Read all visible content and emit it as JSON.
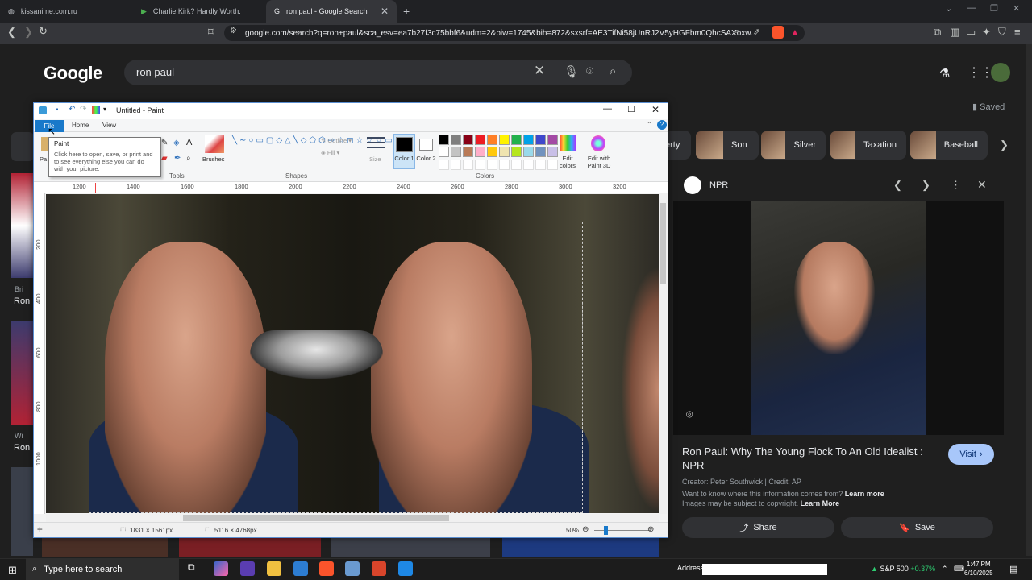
{
  "browser": {
    "tabs": [
      {
        "label": "kissanime.com.ru",
        "active": false
      },
      {
        "label": "Charlie Kirk? Hardly Worth.",
        "active": false
      },
      {
        "label": "ron paul - Google Search",
        "active": true
      }
    ],
    "url": "google.com/search?q=ron+paul&sca_esv=ea7b27f3c75bbf6&udm=2&biw=1745&bih=872&sxsrf=AE3TifNi58jUnRJ2V5yHGFbm0QhcSAXoxw..."
  },
  "google": {
    "logo": "Google",
    "query": "ron paul",
    "saved_label": "Saved",
    "chips": [
      {
        "label": "erty"
      },
      {
        "label": "Son"
      },
      {
        "label": "Silver"
      },
      {
        "label": "Taxation"
      },
      {
        "label": "Baseball"
      }
    ],
    "left_fragments": [
      "Bri",
      "Ron",
      "Wi",
      "Ron"
    ],
    "side_panel": {
      "source": "NPR",
      "title": "Ron Paul: Why The Young Flock To An Old Idealist : NPR",
      "visit_label": "Visit",
      "credit": "Creator: Peter Southwick | Credit: AP",
      "info_text": "Want to know where this information comes from?",
      "info_link": "Learn more",
      "copyright_text": "Images may be subject to copyright.",
      "copyright_link": "Learn More",
      "share_label": "Share",
      "save_label": "Save"
    }
  },
  "paint": {
    "title": "Untitled - Paint",
    "tabs": {
      "file": "File",
      "home": "Home",
      "view": "View"
    },
    "groups": {
      "tools": "Tools",
      "shapes": "Shapes",
      "colors": "Colors"
    },
    "labels": {
      "paste": "Pa",
      "brushes": "Brushes",
      "outline": "Outline",
      "fill": "Fill",
      "size": "Size",
      "color1": "Color 1",
      "color2": "Color 2",
      "edit_colors": "Edit colors",
      "paint3d": "Edit with Paint 3D"
    },
    "tooltip": {
      "title": "Paint",
      "body": "Click here to open, save, or print and to see everything else you can do with your picture."
    },
    "ruler_h": [
      "1200",
      "1400",
      "1600",
      "1800",
      "2000",
      "2200",
      "2400",
      "2600",
      "2800",
      "3000",
      "3200"
    ],
    "ruler_v": [
      "200",
      "400",
      "600",
      "800",
      "1000"
    ],
    "palette": [
      "#000000",
      "#7f7f7f",
      "#880015",
      "#ed1c24",
      "#ff7f27",
      "#fff200",
      "#22b14c",
      "#00a2e8",
      "#3f48cc",
      "#a349a4",
      "#ffffff",
      "#c3c3c3",
      "#b97a57",
      "#ffaec9",
      "#ffc90e",
      "#efe4b0",
      "#b5e61d",
      "#99d9ea",
      "#7092be",
      "#c8bfe7"
    ],
    "status": {
      "selection": "1831 × 1561px",
      "size": "5116 × 4768px",
      "zoom": "50%"
    }
  },
  "taskbar": {
    "search_placeholder": "Type here to search",
    "address_label": "Address",
    "stock_name": "S&P 500",
    "stock_change": "+0.37%",
    "time": "1:47 PM",
    "date": "6/10/2025"
  }
}
